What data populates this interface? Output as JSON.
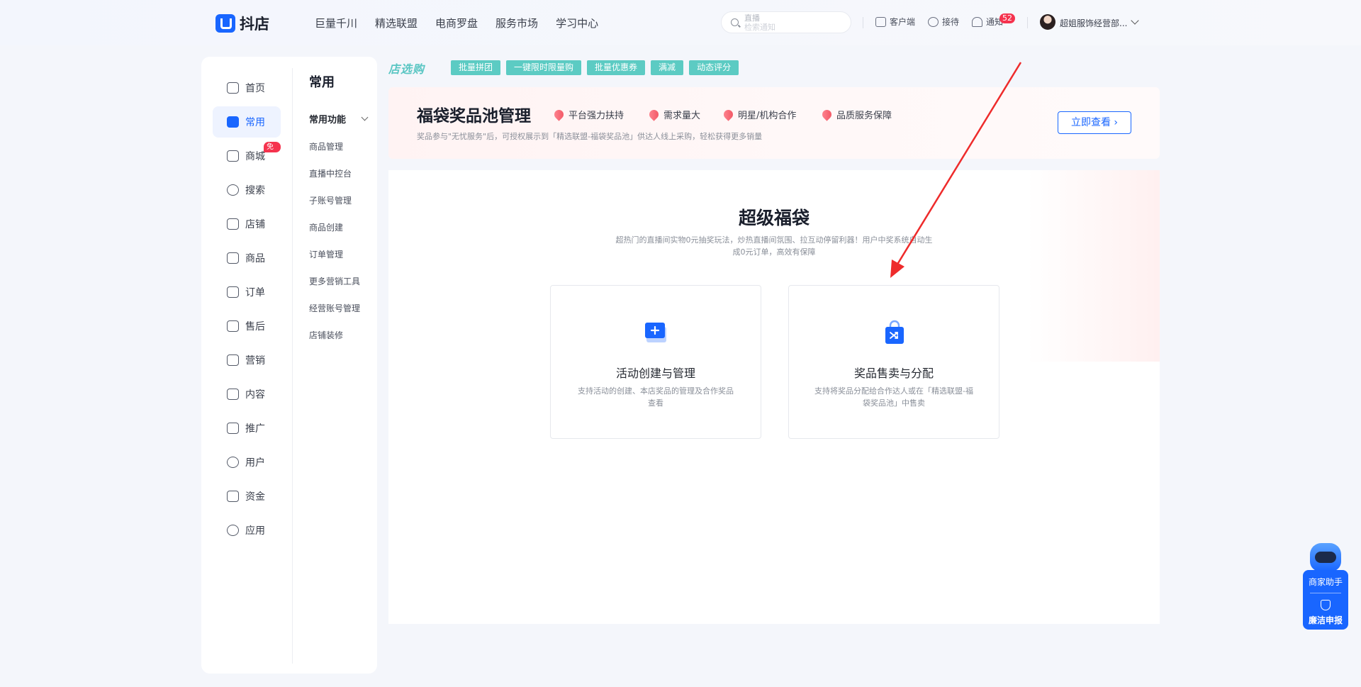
{
  "header": {
    "logo_text": "抖店",
    "nav": [
      "巨量千川",
      "精选联盟",
      "电商罗盘",
      "服务市场",
      "学习中心"
    ],
    "search_placeholder_1": "直播",
    "search_placeholder_2": "检索通知",
    "tools": {
      "customer_label": "客户端",
      "reception_label": "接待",
      "notify_label": "通知",
      "notify_count": "52"
    },
    "username": "超姐服饰经营部..."
  },
  "sidebar": {
    "items": [
      {
        "label": "首页",
        "icon": "home-icon"
      },
      {
        "label": "常用",
        "icon": "common-icon",
        "active": true
      },
      {
        "label": "商城",
        "icon": "mall-icon",
        "badge": "免佣"
      },
      {
        "label": "搜索",
        "icon": "search-icon"
      },
      {
        "label": "店铺",
        "icon": "shop-icon"
      },
      {
        "label": "商品",
        "icon": "goods-icon"
      },
      {
        "label": "订单",
        "icon": "order-icon"
      },
      {
        "label": "售后",
        "icon": "aftersale-icon"
      },
      {
        "label": "营销",
        "icon": "megaphone-icon"
      },
      {
        "label": "内容",
        "icon": "content-icon"
      },
      {
        "label": "推广",
        "icon": "promote-icon"
      },
      {
        "label": "用户",
        "icon": "user-icon"
      },
      {
        "label": "资金",
        "icon": "wallet-icon"
      },
      {
        "label": "应用",
        "icon": "app-icon"
      }
    ]
  },
  "submenu": {
    "title": "常用",
    "group": "常用功能",
    "items": [
      "商品管理",
      "直播中控台",
      "子账号管理",
      "商品创建",
      "订单管理",
      "更多营销工具",
      "经营账号管理",
      "店铺装修"
    ]
  },
  "promo": {
    "logo": "店选购",
    "tags": [
      "批量拼团",
      "一键限时限量购",
      "批量优惠券",
      "满减",
      "动态评分"
    ]
  },
  "banner": {
    "title": "福袋奖品池管理",
    "features": [
      "平台强力扶持",
      "需求量大",
      "明星/机构合作",
      "品质服务保障"
    ],
    "description": "奖品参与\"无忧服务\"后，可授权展示到「精选联盟-福袋奖品池」供达人线上采购，轻松获得更多销量",
    "button": "立即查看 ›"
  },
  "main": {
    "title": "超级福袋",
    "subtitle": "超热门的直播间实物0元抽奖玩法，炒热直播间氛围、拉互动停留利器！用户中奖系统自动生成0元订单，高效有保障",
    "cards": [
      {
        "title": "活动创建与管理",
        "desc": "支持活动的创建、本店奖品的管理及合作奖品查看"
      },
      {
        "title": "奖品售卖与分配",
        "desc": "支持将奖品分配给合作达人或在「精选联盟-福袋奖品池」中售卖"
      }
    ]
  },
  "assistant": {
    "label": "商家助手",
    "report": "廉洁申报"
  },
  "colors": {
    "accent": "#1966ff",
    "tag": "#5ccbc3",
    "badge": "#f5334e",
    "arrow": "#ee2b2b"
  }
}
